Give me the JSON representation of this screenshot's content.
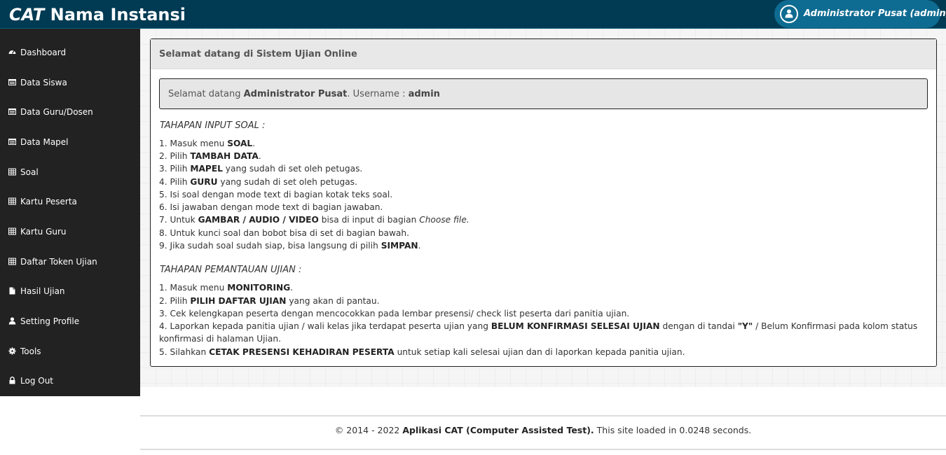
{
  "header": {
    "brand_prefix": "CAT",
    "brand_name": "Nama Instansi",
    "user_label": "Administrator Pusat (admin)"
  },
  "sidebar": {
    "items": [
      {
        "label": "Dashboard",
        "icon": "dashboard-icon"
      },
      {
        "label": "Data Siswa",
        "icon": "list-icon"
      },
      {
        "label": "Data Guru/Dosen",
        "icon": "list-icon"
      },
      {
        "label": "Data Mapel",
        "icon": "list-icon"
      },
      {
        "label": "Soal",
        "icon": "table-icon"
      },
      {
        "label": "Kartu Peserta",
        "icon": "table-icon"
      },
      {
        "label": "Kartu Guru",
        "icon": "table-icon"
      },
      {
        "label": "Daftar Token Ujian",
        "icon": "table-icon"
      },
      {
        "label": "Hasil Ujian",
        "icon": "file-icon"
      },
      {
        "label": "Setting Profile",
        "icon": "user-icon"
      },
      {
        "label": "Tools",
        "icon": "gear-icon"
      },
      {
        "label": "Log Out",
        "icon": "lock-icon"
      }
    ]
  },
  "panel": {
    "title": "Selamat datang di Sistem Ujian Online",
    "welcome": {
      "prefix": "Selamat datang ",
      "name": "Administrator Pusat",
      "middle": ". Username : ",
      "username": "admin"
    },
    "input_title": "TAHAPAN INPUT SOAL :",
    "input_steps": [
      [
        {
          "t": "1. Masuk menu "
        },
        {
          "t": "SOAL",
          "b": true
        },
        {
          "t": "."
        }
      ],
      [
        {
          "t": "2. Pilih "
        },
        {
          "t": "TAMBAH DATA",
          "b": true
        },
        {
          "t": "."
        }
      ],
      [
        {
          "t": "3. Pilih "
        },
        {
          "t": "MAPEL",
          "b": true
        },
        {
          "t": " yang sudah di set oleh petugas."
        }
      ],
      [
        {
          "t": "4. Pilih "
        },
        {
          "t": "GURU",
          "b": true
        },
        {
          "t": " yang sudah di set oleh petugas."
        }
      ],
      [
        {
          "t": "5. Isi soal dengan mode text di bagian kotak teks soal."
        }
      ],
      [
        {
          "t": "6. Isi jawaban dengan mode text di bagian jawaban."
        }
      ],
      [
        {
          "t": "7. Untuk "
        },
        {
          "t": "GAMBAR / AUDIO / VIDEO",
          "b": true
        },
        {
          "t": " bisa di input di bagian "
        },
        {
          "t": "Choose file.",
          "i": true
        }
      ],
      [
        {
          "t": "8. Untuk kunci soal dan bobot bisa di set di bagian bawah."
        }
      ],
      [
        {
          "t": "9. Jika sudah soal sudah siap, bisa langsung di pilih "
        },
        {
          "t": "SIMPAN",
          "b": true
        },
        {
          "t": "."
        }
      ]
    ],
    "monitor_title": "TAHAPAN PEMANTAUAN UJIAN :",
    "monitor_steps": [
      [
        {
          "t": "1. Masuk menu "
        },
        {
          "t": "MONITORING",
          "b": true
        },
        {
          "t": "."
        }
      ],
      [
        {
          "t": "2. Pilih "
        },
        {
          "t": "PILIH DAFTAR UJIAN",
          "b": true
        },
        {
          "t": " yang akan di pantau."
        }
      ],
      [
        {
          "t": "3. Cek kelengkapan peserta dengan mencocokkan pada lembar presensi/ check list peserta dari panitia ujian."
        }
      ],
      [
        {
          "t": "4. Laporkan kepada panitia ujian / wali kelas jika terdapat peserta ujian yang "
        },
        {
          "t": "BELUM KONFIRMASI SELESAI UJIAN",
          "b": true
        },
        {
          "t": " dengan di tandai "
        },
        {
          "t": "\"Y\"",
          "b": true
        },
        {
          "t": " / Belum Konfirmasi pada kolom status konfirmasi di halaman Ujian."
        }
      ],
      [
        {
          "t": "5. Silahkan "
        },
        {
          "t": "CETAK PRESENSI KEHADIRAN PESERTA",
          "b": true
        },
        {
          "t": " untuk setiap kali selesai ujian dan di laporkan kepada panitia ujian."
        }
      ]
    ]
  },
  "footer": {
    "prefix": "© 2014 - 2022 ",
    "app_name": "Aplikasi CAT (Computer Assisted Test).",
    "suffix": " This site loaded in 0.0248 seconds."
  }
}
